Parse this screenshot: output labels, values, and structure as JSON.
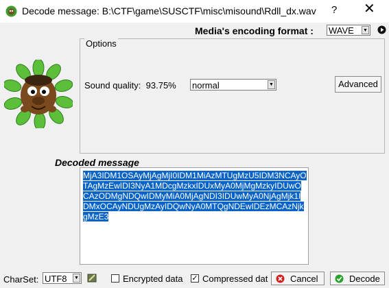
{
  "window": {
    "title": "Decode message: B:\\CTF\\game\\SUSCTF\\misc\\misound\\Rdll_dx.wav",
    "help": "?",
    "close": "✕"
  },
  "encoding": {
    "label": "Media's encoding format :",
    "value": "WAVE"
  },
  "options": {
    "legend": "Options",
    "sound_quality_label": "Sound quality:",
    "sound_quality_percent": "93.75%",
    "quality_value": "normal",
    "advanced_label": "Advanced"
  },
  "decoded": {
    "label": "Decoded message",
    "text": "MjA3IDM1OSAyMjAgMjI0IDM1MiAzMTUgMzU5IDM3NCAyOTAgMzEwIDI3NyA1MDcgMzkxIDUxMyA0MjMgMzkyIDUwOCAzODMgNDQwIDMyMiA0MjAgNDI3IDUwMyA0NjAgMjk1IDMxOCAyNDUgMzAyIDQwNyA0MTQgNDEwIDEzMCAzNjkgMzE3"
  },
  "footer": {
    "charset_label": "CharSet:",
    "charset_value": "UTF8",
    "encrypted_label": "Encrypted data",
    "encrypted_checked": false,
    "compressed_label": "Compressed dat",
    "compressed_checked": true,
    "cancel_label": "Cancel",
    "decode_label": "Decode"
  },
  "icons": {
    "app": "mascot-app-icon",
    "play": "play-icon",
    "charset": "edit-charset-icon",
    "cancel": "cancel-x-icon",
    "decode": "decode-check-icon"
  },
  "colors": {
    "selection": "#0a64c8",
    "cancel_icon": "#d02020",
    "decode_icon": "#2ca02c"
  }
}
